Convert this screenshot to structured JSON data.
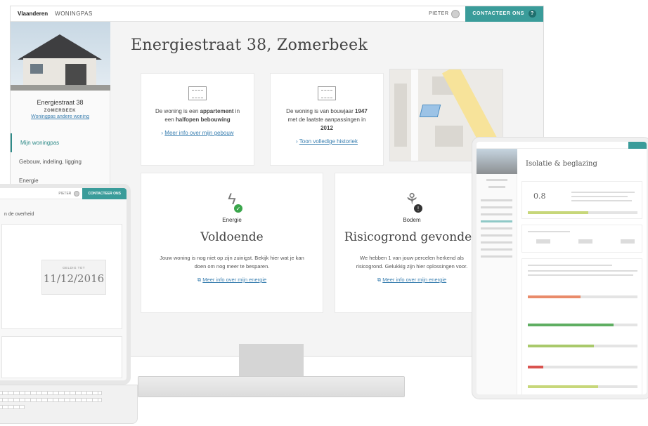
{
  "desktop": {
    "topbar": {
      "brand": "Vlaanderen",
      "section": "WONINGPAS",
      "user": "PIETER",
      "contact_label": "CONTACTEER ONS",
      "help": "?"
    },
    "sidebar": {
      "address": "Energiestraat 38",
      "city": "ZOMERBEEK",
      "other_link": "Woningpas andere woning",
      "nav": [
        "Mijn woningpas",
        "Gebouw, indeling, ligging",
        "Energie"
      ]
    },
    "page_title": "Energiestraat 38, Zomerbeek",
    "cards": [
      {
        "text_parts": [
          "De woning is een ",
          "appartement",
          " in een ",
          "halfopen",
          " bebouwing"
        ],
        "link": "Meer info over mijn gebouw"
      },
      {
        "text_parts": [
          "De woning is van bouwjaar ",
          "1947",
          " met de laatste aanpassingen in ",
          "2012"
        ],
        "link": "Toon volledige historiek"
      }
    ],
    "energy": {
      "label": "Energie",
      "value": "Voldoende",
      "description": "Jouw woning is nog niet op zijn zuinigst. Bekijk hier wat je kan doen om nog meer te besparen.",
      "link": "Meer info over mijn energie",
      "badge": "✓",
      "badge_color": "#3aa64b"
    },
    "soil": {
      "label": "Bodem",
      "value": "Risicogrond gevonden",
      "description": "We hebben 1 van jouw percelen herkend als risicogrond. Gelukkig zijn hier oplossingen voor.",
      "link": "Meer info over mijn energie",
      "badge": "!",
      "badge_color": "#333333"
    },
    "link_color": "#3a7fb0",
    "accent_color": "#3a9c9a"
  },
  "laptop": {
    "user": "PIETER",
    "contact_label": "CONTACTEER ONS",
    "heading": "n de overheid",
    "date_label": "GELDIG TOT",
    "date": "11/12/2016"
  },
  "tablet": {
    "title": "Isolatie & beglazing",
    "value": "0.8"
  }
}
